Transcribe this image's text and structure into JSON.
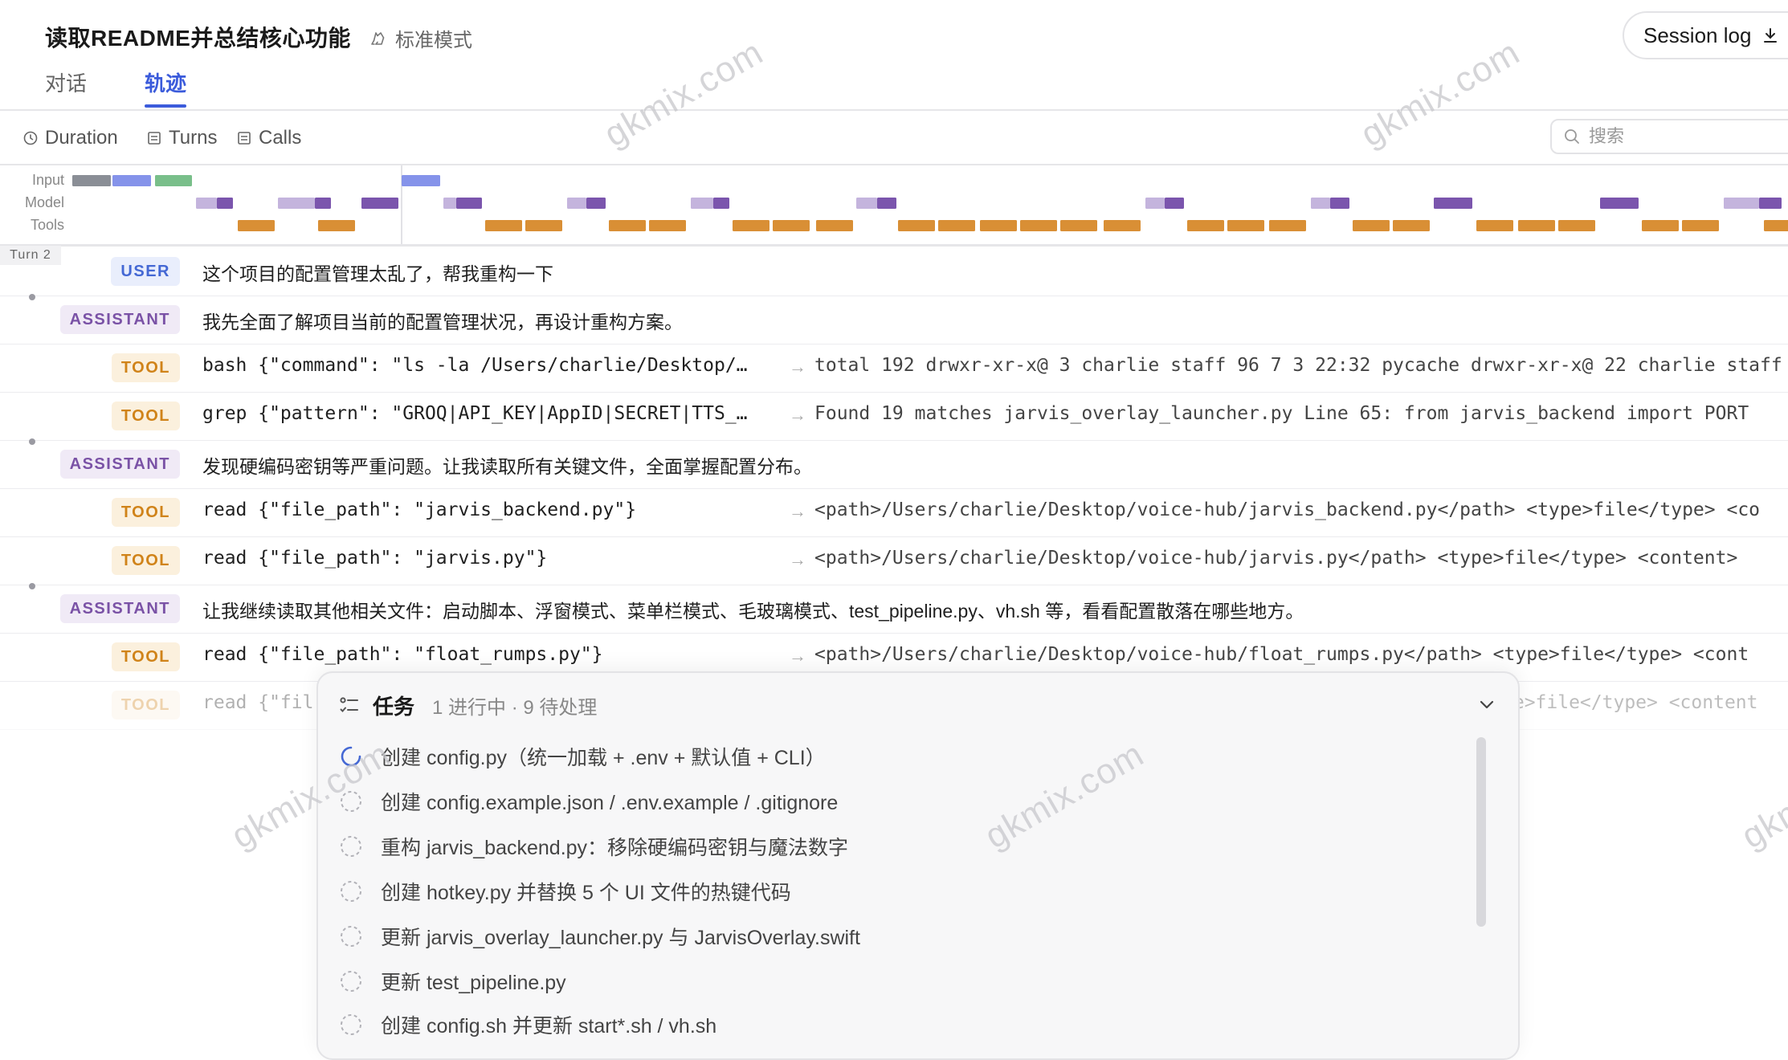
{
  "header": {
    "title": "读取README并总结核心功能",
    "mode_label": "标准模式",
    "session_log_label": "Session log",
    "tabs": [
      {
        "label": "对话",
        "active": false
      },
      {
        "label": "轨迹",
        "active": true
      }
    ]
  },
  "toolbar": {
    "duration_label": "Duration",
    "turns_label": "Turns",
    "calls_label": "Calls",
    "search_placeholder": "搜索"
  },
  "timeline": {
    "lanes": [
      "Input",
      "Model",
      "Tools"
    ],
    "colors": {
      "input_gray": "#8a8e96",
      "input_blue": "#8593ea",
      "input_green": "#79bf8a",
      "model_light": "#c4b4dd",
      "model_dark": "#7b55ad",
      "tool": "#d98f35"
    }
  },
  "turn_label": "Turn 2",
  "rows": [
    {
      "role": "USER",
      "text": "这个项目的配置管理太乱了，帮我重构一下"
    },
    {
      "role": "ASSISTANT",
      "text": "我先全面了解项目当前的配置管理状况，再设计重构方案。"
    },
    {
      "role": "TOOL",
      "call": "bash {\"command\": \"ls -la /Users/charlie/Desktop/…",
      "arrow": "→",
      "result": "total 192 drwxr-xr-x@ 3 charlie staff 96 7 3 22:32 pycache drwxr-xr-x@ 22 charlie staff"
    },
    {
      "role": "TOOL",
      "call": "grep {\"pattern\": \"GROQ|API_KEY|AppID|SECRET|TTS_…",
      "arrow": "→",
      "result": "Found 19 matches jarvis_overlay_launcher.py Line 65: from jarvis_backend import PORT"
    },
    {
      "role": "ASSISTANT",
      "text": "发现硬编码密钥等严重问题。让我读取所有关键文件，全面掌握配置分布。"
    },
    {
      "role": "TOOL",
      "call": "read {\"file_path\": \"jarvis_backend.py\"}",
      "arrow": "→",
      "result": "<path>/Users/charlie/Desktop/voice-hub/jarvis_backend.py</path> <type>file</type> <co"
    },
    {
      "role": "TOOL",
      "call": "read {\"file_path\": \"jarvis.py\"}",
      "arrow": "→",
      "result": "<path>/Users/charlie/Desktop/voice-hub/jarvis.py</path> <type>file</type> <content>"
    },
    {
      "role": "ASSISTANT",
      "text": "让我继续读取其他相关文件：启动脚本、浮窗模式、菜单栏模式、毛玻璃模式、test_pipeline.py、vh.sh 等，看看配置散落在哪些地方。"
    },
    {
      "role": "TOOL",
      "call": "read {\"file_path\": \"float_rumps.py\"}",
      "arrow": "→",
      "result": "<path>/Users/charlie/Desktop/voice-hub/float_rumps.py</path> <type>file</type> <cont"
    },
    {
      "role": "TOOL",
      "call": "read {\"fil",
      "arrow": "",
      "result": "pe>file</type> <content"
    }
  ],
  "tasks": {
    "title": "任务",
    "status": "1 进行中 · 9 待处理",
    "items": [
      {
        "text": "创建 config.py（统一加载 + .env + 默认值 + CLI）",
        "state": "in_progress"
      },
      {
        "text": "创建 config.example.json / .env.example / .gitignore",
        "state": "pending"
      },
      {
        "text": "重构 jarvis_backend.py：移除硬编码密钥与魔法数字",
        "state": "pending"
      },
      {
        "text": "创建 hotkey.py 并替换 5 个 UI 文件的热键代码",
        "state": "pending"
      },
      {
        "text": "更新 jarvis_overlay_launcher.py 与 JarvisOverlay.swift",
        "state": "pending"
      },
      {
        "text": "更新 test_pipeline.py",
        "state": "pending"
      },
      {
        "text": "创建 config.sh 并更新 start*.sh / vh.sh",
        "state": "pending"
      }
    ]
  },
  "watermark": "gkmix.com"
}
